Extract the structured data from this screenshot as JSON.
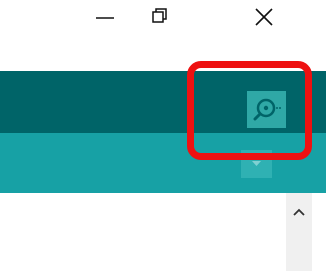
{
  "window_controls": {
    "minimize_icon": "minimize-icon",
    "restore_icon": "restore-icon",
    "close_icon": "close-icon"
  },
  "toolbar": {
    "serial_monitor_icon": "serial-monitor-icon"
  },
  "tabs": {
    "menu_icon": "chevron-down-icon"
  },
  "editor": {
    "scroll_up_icon": "chevron-up-icon"
  },
  "colors": {
    "toolbar_bg": "#006468",
    "tabstrip_bg": "#17a1a5",
    "button_bg": "#2fa8a6",
    "highlight": "#ee1111"
  }
}
